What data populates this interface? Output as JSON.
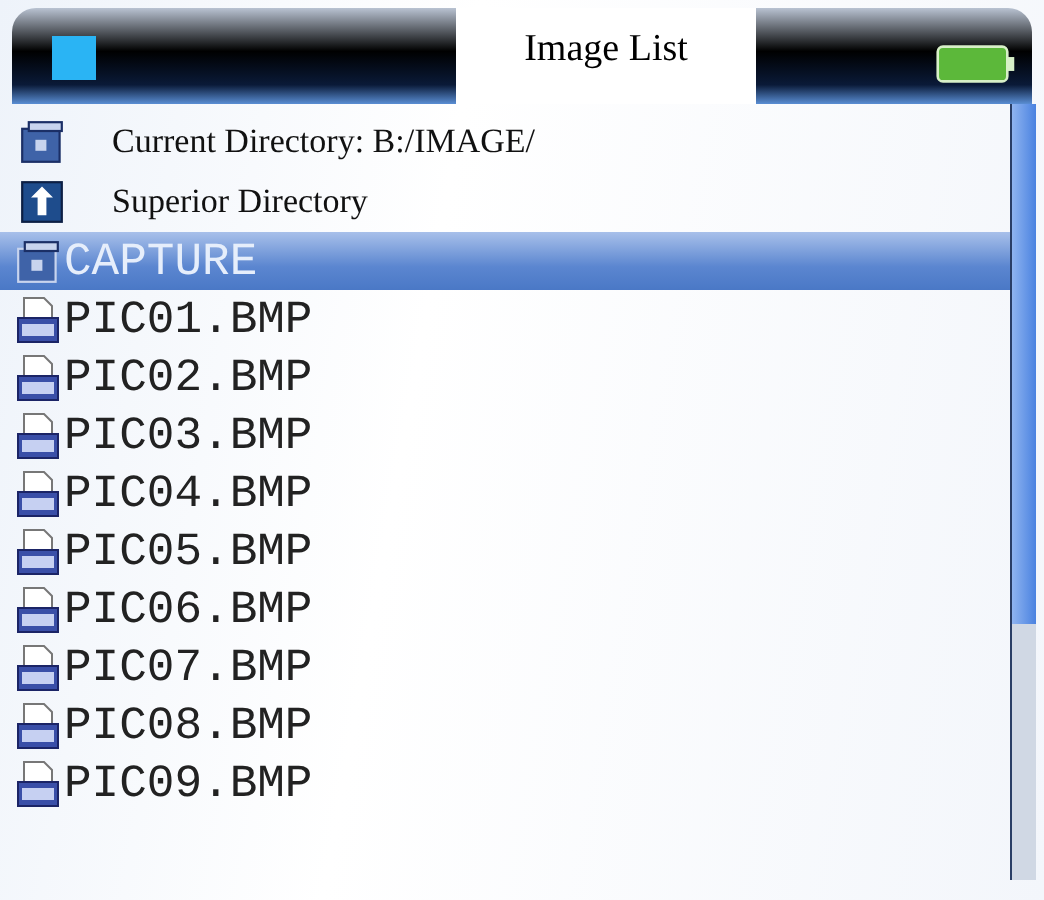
{
  "header": {
    "title": "Image List"
  },
  "info_rows": [
    {
      "kind": "folder",
      "label": "Current Directory: B:/IMAGE/"
    },
    {
      "kind": "up",
      "label": "Superior Directory"
    }
  ],
  "entries": [
    {
      "kind": "folder",
      "name": "CAPTURE",
      "selected": true
    },
    {
      "kind": "bmp",
      "name": "PIC01.BMP",
      "selected": false
    },
    {
      "kind": "bmp",
      "name": "PIC02.BMP",
      "selected": false
    },
    {
      "kind": "bmp",
      "name": "PIC03.BMP",
      "selected": false
    },
    {
      "kind": "bmp",
      "name": "PIC04.BMP",
      "selected": false
    },
    {
      "kind": "bmp",
      "name": "PIC05.BMP",
      "selected": false
    },
    {
      "kind": "bmp",
      "name": "PIC06.BMP",
      "selected": false
    },
    {
      "kind": "bmp",
      "name": "PIC07.BMP",
      "selected": false
    },
    {
      "kind": "bmp",
      "name": "PIC08.BMP",
      "selected": false
    },
    {
      "kind": "bmp",
      "name": "PIC09.BMP",
      "selected": false
    }
  ]
}
